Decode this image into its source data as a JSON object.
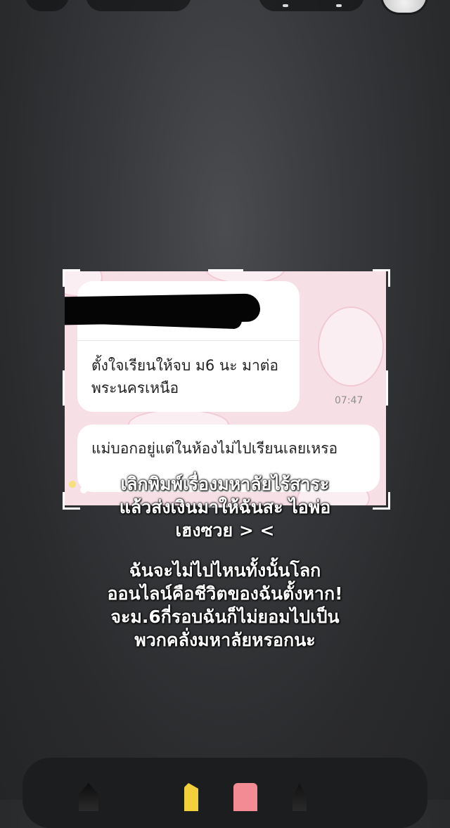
{
  "chat_screenshot": {
    "message_1": "ตั้งใจเรียนให้จบ ม6 นะ มาต่อพระนครเหนือ",
    "message_1_time": "07:47",
    "message_2": "แม่บอกอยู่แต่ในห้องไม่ไปเรียนเลยเหรอ"
  },
  "caption": {
    "paragraph_1": [
      "เลิกพิมพ์เรื่องมหาลัยไร้สาระ",
      "แล้วส่งเงินมาให้ฉันสะ ไอพ่อ",
      "เฮงซวย > <"
    ],
    "paragraph_2": [
      "ฉันจะไม่ไปไหนทั้งนั้นโลก",
      "ออนไลน์คือชีวิตของฉันตั้งหาก!",
      "จะม.6กี่รอบฉันก็ไม่ยอมไปเป็น",
      "พวกคลั่งมหาลัยหรอกนะ"
    ]
  },
  "tools": [
    "pen-tool",
    "marker-tool",
    "eraser-tool",
    "pencil-tool"
  ],
  "colors": {
    "background": "#2e2f31",
    "chat_background": "#f7dfe6",
    "caption_text": "#ffffff",
    "marker": "#f2d03b",
    "eraser": "#f28b93"
  }
}
